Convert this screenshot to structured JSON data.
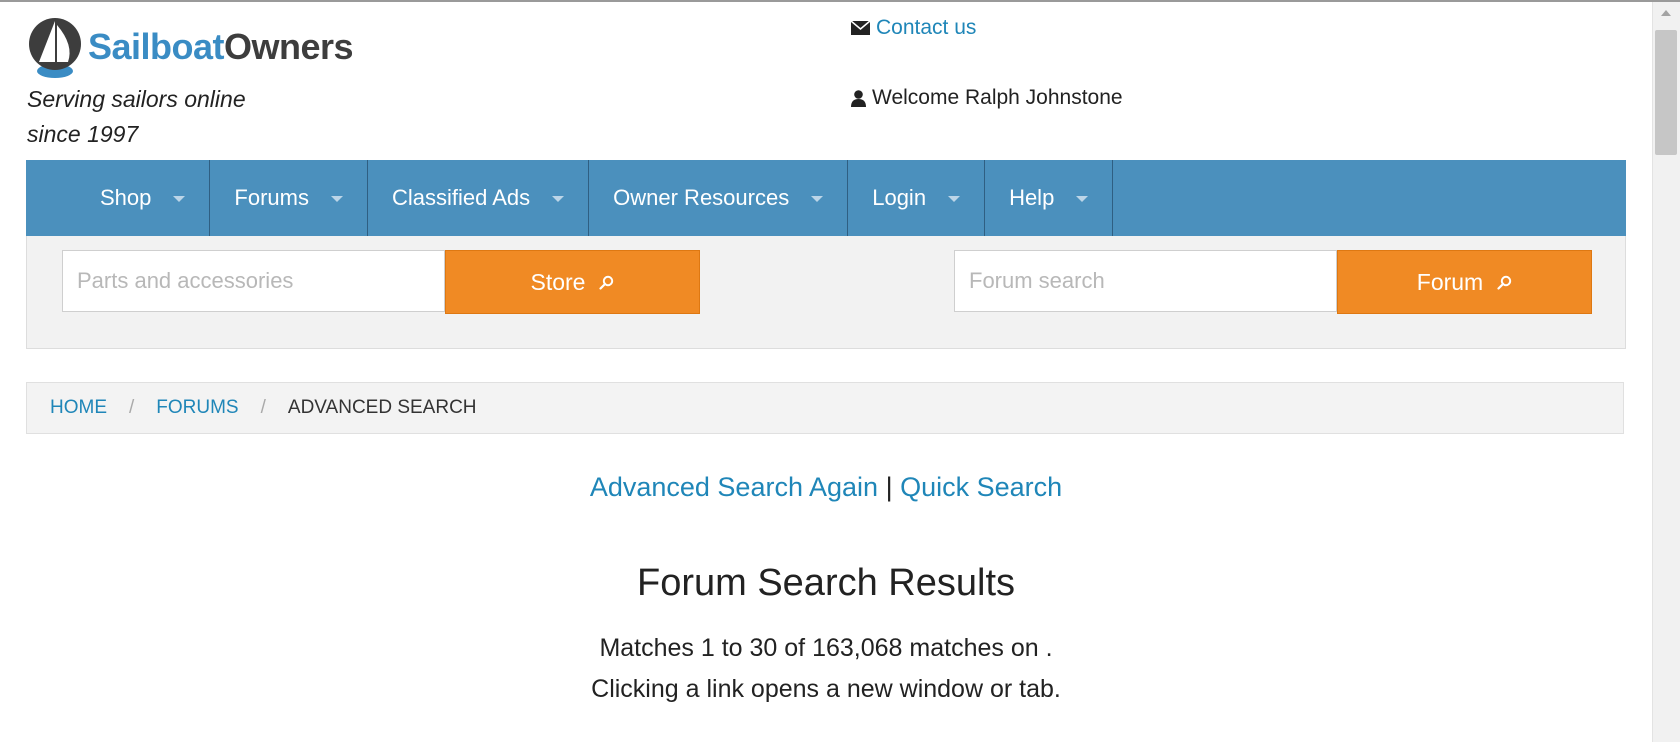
{
  "brand": {
    "name_part1": "Sailboat",
    "name_part2": "Owners",
    "tagline_line1": "Serving sailors online",
    "tagline_line2": "since 1997",
    "logo_icon": "sailboat-logo-icon"
  },
  "header": {
    "contact_label": "Contact us",
    "contact_icon": "envelope-icon",
    "welcome_text": "Welcome Ralph Johnstone",
    "welcome_icon": "user-icon"
  },
  "nav": {
    "items": [
      {
        "label": "Shop"
      },
      {
        "label": "Forums"
      },
      {
        "label": "Classified Ads"
      },
      {
        "label": "Owner Resources"
      },
      {
        "label": "Login"
      },
      {
        "label": "Help"
      }
    ]
  },
  "search": {
    "store_placeholder": "Parts and accessories",
    "store_button": "Store",
    "forum_placeholder": "Forum search",
    "forum_button": "Forum",
    "button_icon": "search-icon"
  },
  "breadcrumb": {
    "items": [
      "HOME",
      "FORUMS",
      "ADVANCED SEARCH"
    ],
    "separator": "/"
  },
  "main": {
    "advanced_search_again": "Advanced Search Again",
    "link_separator": "|",
    "quick_search": "Quick Search",
    "title": "Forum Search Results",
    "matches_line": "Matches 1 to 30 of 163,068 matches on .",
    "hint_line": "Clicking a link opens a new window or tab."
  },
  "colors": {
    "nav_bg": "#4b90bd",
    "accent_orange": "#f08a24",
    "link_blue": "#1f86b8",
    "brand_blue": "#3a8cc4",
    "brand_dark": "#3d3d3d"
  }
}
